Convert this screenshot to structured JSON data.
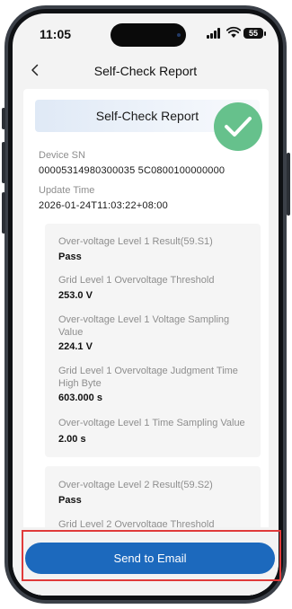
{
  "status_bar": {
    "time": "11:05",
    "battery": "55"
  },
  "nav": {
    "title": "Self-Check Report"
  },
  "report": {
    "header_title": "Self-Check Report",
    "device_sn_label": "Device SN",
    "device_sn_value": "00005314980300035 5C0800100000000",
    "update_time_label": "Update Time",
    "update_time_value": "2026-01-24T11:03:22+08:00"
  },
  "section1": {
    "items": [
      {
        "label": "Over-voltage Level 1 Result(59.S1)",
        "value": "Pass"
      },
      {
        "label": "Grid Level 1 Overvoltage Threshold",
        "value": "253.0 V"
      },
      {
        "label": "Over-voltage Level 1 Voltage Sampling Value",
        "value": "224.1 V"
      },
      {
        "label": "Grid Level 1 Overvoltage Judgment Time High Byte",
        "value": "603.000 s"
      },
      {
        "label": "Over-voltage Level 1 Time Sampling Value",
        "value": "2.00 s"
      }
    ]
  },
  "section2": {
    "items": [
      {
        "label": "Over-voltage Level 2 Result(59.S2)",
        "value": "Pass"
      },
      {
        "label": "Grid Level 2 Overvoltage Threshold",
        "value": ""
      }
    ]
  },
  "actions": {
    "send_email_label": "Send to Email"
  },
  "colors": {
    "primary": "#1c69bd",
    "success": "#66c18c",
    "highlight": "#e03a3a"
  }
}
